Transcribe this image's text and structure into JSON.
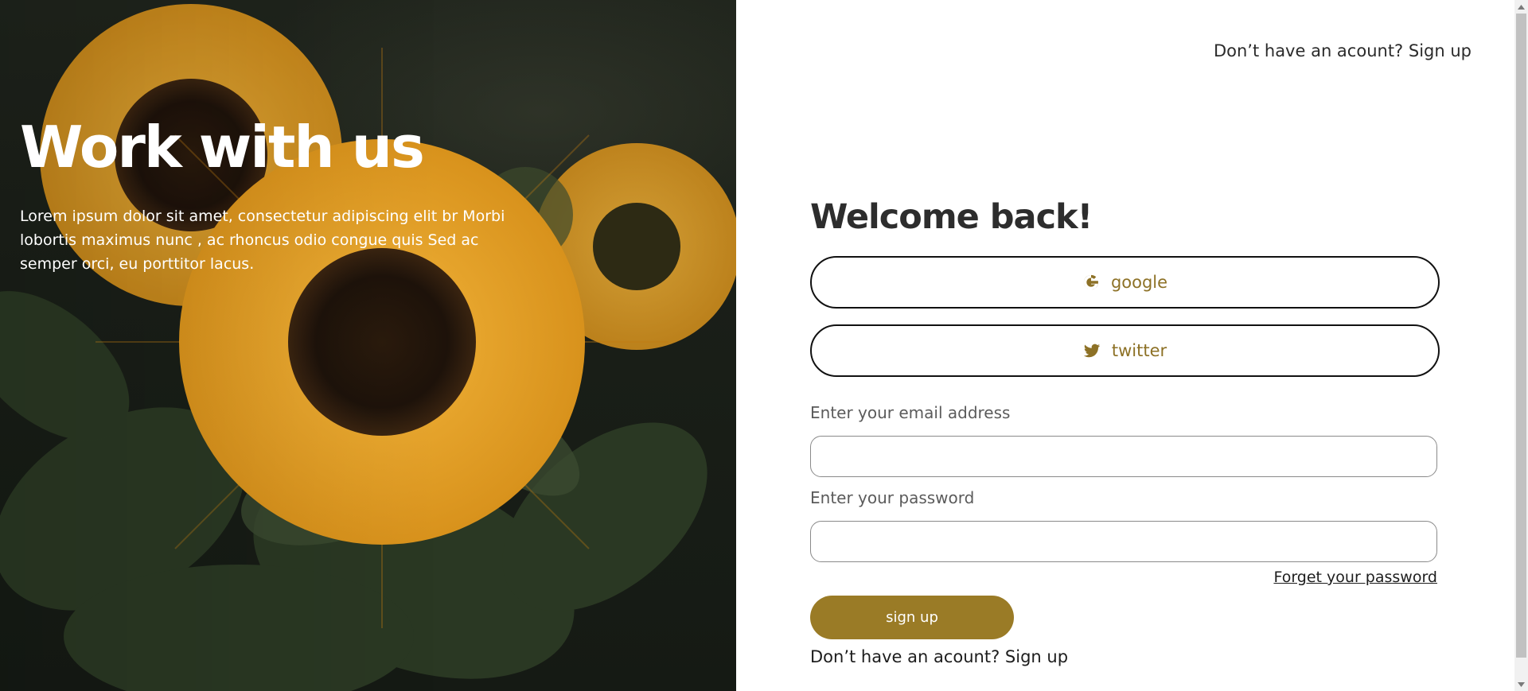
{
  "hero": {
    "title": "Work with us",
    "description": "Lorem ipsum dolor sit amet, consectetur adipiscing elit br Morbi lobortis maximus nunc , ac rhoncus odio congue quis Sed ac semper orci, eu porttitor lacus.",
    "image_subject": "sunflowers"
  },
  "header": {
    "signup_link": "Don’t have an acount? Sign up"
  },
  "form": {
    "title": "Welcome back!",
    "social": {
      "google_label": "google",
      "google_icon": "google-icon",
      "twitter_label": "twitter",
      "twitter_icon": "twitter-icon"
    },
    "email_label": "Enter your email address",
    "email_value": "",
    "password_label": "Enter your password",
    "password_value": "",
    "forgot_link": "Forget your password",
    "submit_label": "sign up",
    "bottom_signup_link": "Don’t have an acount? Sign up"
  },
  "colors": {
    "accent": "#9a7b26",
    "social_text": "#8d7126",
    "heading": "#2d2d2d"
  }
}
